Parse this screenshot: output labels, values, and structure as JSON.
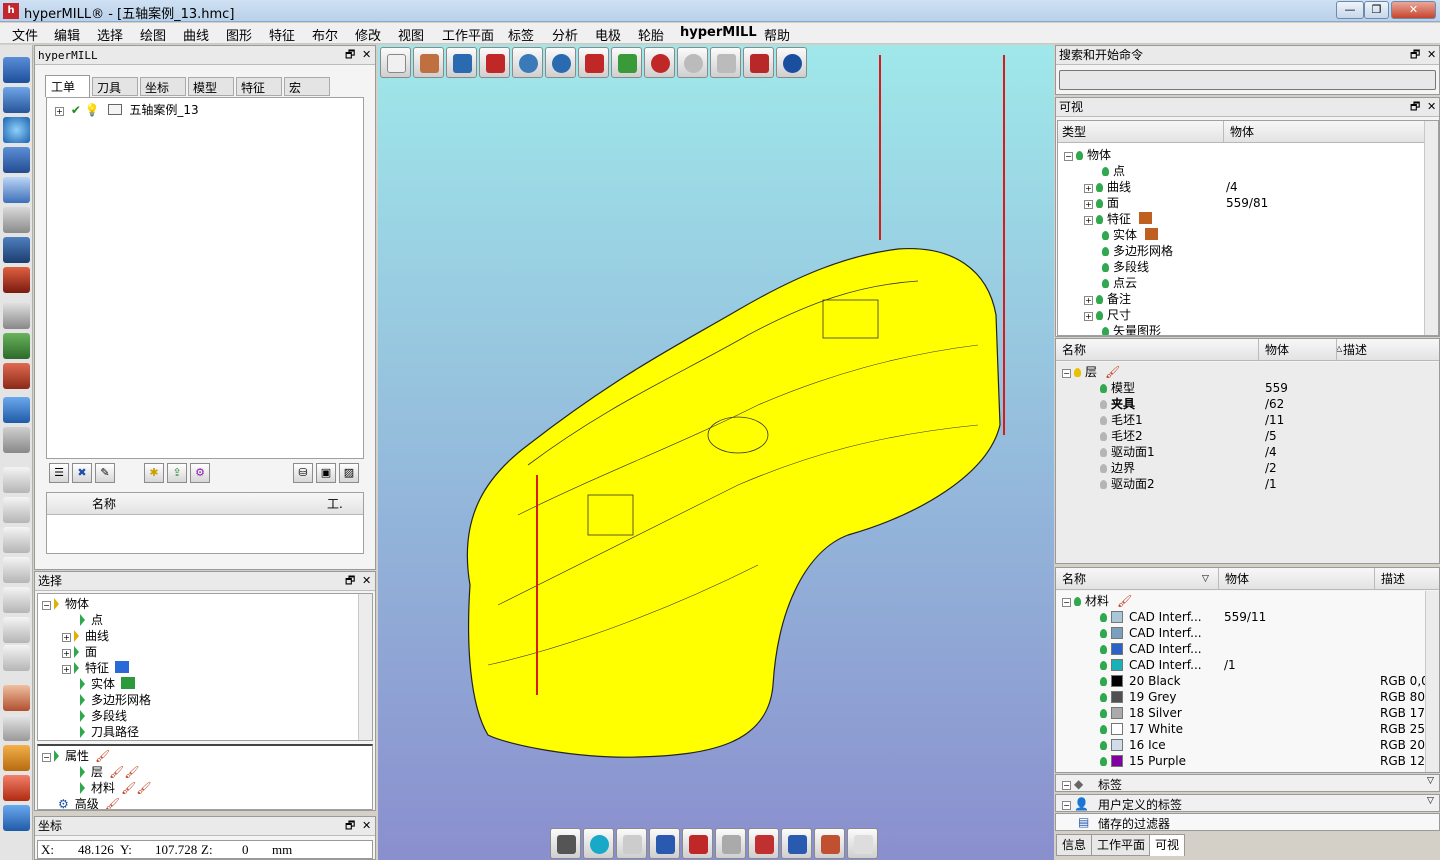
{
  "window": {
    "title": "hyperMILL® - [五轴案例_13.hmc]",
    "min": "—",
    "max": "❐",
    "close": "✕",
    "logo_letter": "h"
  },
  "menu": [
    "文件",
    "编辑",
    "选择",
    "绘图",
    "曲线",
    "图形",
    "特征",
    "布尔",
    "修改",
    "视图",
    "工作平面",
    "标签",
    "分析",
    "电极",
    "轮胎",
    "hyperMILL",
    "帮助"
  ],
  "browser": {
    "title": "hyperMILL",
    "tabs": [
      "工单",
      "刀具",
      "坐标",
      "模型",
      "特征",
      "宏"
    ],
    "job": "五轴案例_13",
    "list_header": "名称",
    "list_header2": "工."
  },
  "selection": {
    "title": "选择",
    "items": [
      "物体",
      "点",
      "曲线",
      "面",
      "特征",
      "实体",
      "多边形网格",
      "多段线",
      "刀具路径"
    ],
    "props": [
      "属性",
      "层",
      "材料",
      "高级"
    ]
  },
  "coords": {
    "title": "坐标",
    "x_label": "X:",
    "x": "48.126",
    "y_label": "Y:",
    "y": "107.728",
    "z_label": "Z:",
    "z": "0",
    "unit": "mm"
  },
  "search": {
    "title": "搜索和开始命令"
  },
  "visibility": {
    "title": "可视",
    "col_type": "类型",
    "col_obj": "物体",
    "rows": [
      {
        "name": "物体",
        "val": ""
      },
      {
        "name": "点",
        "val": ""
      },
      {
        "name": "曲线",
        "val": "/4"
      },
      {
        "name": "面",
        "val": "559/81"
      },
      {
        "name": "特征",
        "val": ""
      },
      {
        "name": "实体",
        "val": ""
      },
      {
        "name": "多边形网格",
        "val": ""
      },
      {
        "name": "多段线",
        "val": ""
      },
      {
        "name": "点云",
        "val": ""
      },
      {
        "name": "备注",
        "val": ""
      },
      {
        "name": "尺寸",
        "val": ""
      },
      {
        "name": "矢量图形",
        "val": ""
      }
    ]
  },
  "layers": {
    "col_name": "名称",
    "col_obj": "物体",
    "col_desc": "描述",
    "root": "层",
    "rows": [
      {
        "name": "模型",
        "val": "559",
        "on": true
      },
      {
        "name": "夹具",
        "val": "/62",
        "on": false
      },
      {
        "name": "毛坯1",
        "val": "/11",
        "on": false
      },
      {
        "name": "毛坯2",
        "val": "/5",
        "on": false
      },
      {
        "name": "驱动面1",
        "val": "/4",
        "on": false
      },
      {
        "name": "边界",
        "val": "/2",
        "on": false
      },
      {
        "name": "驱动面2",
        "val": "/1",
        "on": false
      }
    ]
  },
  "materials": {
    "col_name": "名称",
    "col_obj": "物体",
    "col_desc": "描述",
    "root": "材料",
    "rows": [
      {
        "name": "CAD Interf...",
        "val": "559/11",
        "desc": "",
        "color": "#a8c8d8"
      },
      {
        "name": "CAD Interf...",
        "val": "",
        "desc": "",
        "color": "#7aa0c0"
      },
      {
        "name": "CAD Interf...",
        "val": "",
        "desc": "",
        "color": "#2a62c8"
      },
      {
        "name": "CAD Interf...",
        "val": "/1",
        "desc": "",
        "color": "#1ab0b8"
      },
      {
        "name": "20 Black",
        "val": "",
        "desc": "RGB 0,0",
        "color": "#000000"
      },
      {
        "name": "19 Grey",
        "val": "",
        "desc": "RGB 80,",
        "color": "#505050"
      },
      {
        "name": "18 Silver",
        "val": "",
        "desc": "RGB 17(",
        "color": "#aaaaaa"
      },
      {
        "name": "17 White",
        "val": "",
        "desc": "RGB 25!",
        "color": "#ffffff"
      },
      {
        "name": "16 Ice",
        "val": "",
        "desc": "RGB 20:",
        "color": "#d0dce8"
      },
      {
        "name": "15 Purple",
        "val": "",
        "desc": "RGB 12(",
        "color": "#8000a0"
      }
    ]
  },
  "tags": {
    "label": "标签"
  },
  "user_tags": {
    "label": "用户定义的标签"
  },
  "saved_filters": {
    "label": "储存的过滤器"
  },
  "bottom_tabs": [
    "信息",
    "工作平面",
    "可视"
  ],
  "colors": {
    "viewport_top": "#9fe8ea",
    "viewport_bottom": "#8a8fce",
    "part": "#ffff00",
    "axis_line": "#d81a1a"
  }
}
